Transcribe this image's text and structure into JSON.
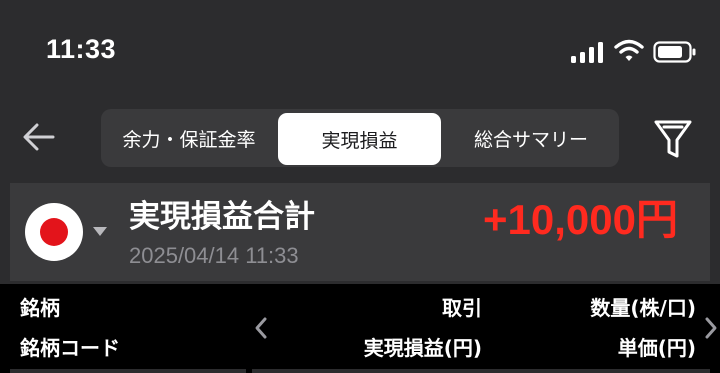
{
  "status_bar": {
    "time": "11:33",
    "icons": [
      "signal-icon",
      "wifi-icon",
      "battery-icon"
    ]
  },
  "nav": {
    "back_icon": "back-arrow-icon",
    "tabs": [
      {
        "label": "余力・保証金率",
        "selected": false
      },
      {
        "label": "実現損益",
        "selected": true
      },
      {
        "label": "総合サマリー",
        "selected": false
      }
    ],
    "filter_icon": "filter-icon"
  },
  "summary": {
    "market_icon": "japan-flag-icon",
    "title": "実現損益合計",
    "timestamp": "2025/04/14 11:33",
    "total": "+10,000円"
  },
  "table_header": {
    "col1_row1": "銘柄",
    "col1_row2": "銘柄コード",
    "col2_row1": "取引",
    "col2_row2": "実現損益(円)",
    "col3_row1": "数量(株/口)",
    "col3_row2": "単価(円)"
  },
  "colors": {
    "background": "#2c2c2e",
    "card": "#3a3a3c",
    "accent_positive": "#ff2a1f",
    "muted_text": "#8e8e93"
  }
}
